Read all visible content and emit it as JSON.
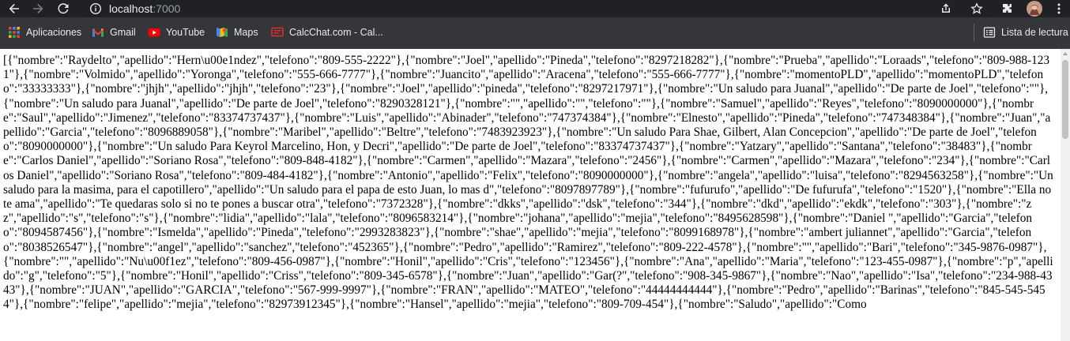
{
  "browser": {
    "url_host": "localhost",
    "url_port": ":7000",
    "reading_list_label": "Lista de lectura"
  },
  "bookmarks": [
    {
      "label": "Aplicaciones",
      "icon": "apps-grid-icon"
    },
    {
      "label": "Gmail",
      "icon": "gmail-icon"
    },
    {
      "label": "YouTube",
      "icon": "youtube-icon"
    },
    {
      "label": "Maps",
      "icon": "maps-icon"
    },
    {
      "label": "CalcChat.com - Cal...",
      "icon": "calcchat-icon"
    }
  ],
  "page": {
    "json_text": "[{\"nombre\":\"Raydelto\",\"apellido\":\"Hern\\u00e1ndez\",\"telefono\":\"809-555-2222\"},{\"nombre\":\"Joel\",\"apellido\":\"Pineda\",\"telefono\":\"8297218282\"},{\"nombre\":\"Prueba\",\"apellido\":\"Loraads\",\"telefono\":\"809-988-1231\"},{\"nombre\":\"Volmido\",\"apellido\":\"Yoronga\",\"telefono\":\"555-666-7777\"},{\"nombre\":\"Juancito\",\"apellido\":\"Aracena\",\"telefono\":\"555-666-7777\"},{\"nombre\":\"momentoPLD\",\"apellido\":\"momentoPLD\",\"telefono\":\"33333333\"},{\"nombre\":\"jhjh\",\"apellido\":\"jhjh\",\"telefono\":\"23\"},{\"nombre\":\"Joel\",\"apellido\":\"pineda\",\"telefono\":\"8297217971\"},{\"nombre\":\"Un saludo para Juanal\",\"apellido\":\"De parte de Joel\",\"telefono\":\"\"},{\"nombre\":\"Un saludo para Juanal\",\"apellido\":\"De parte de Joel\",\"telefono\":\"8290328121\"},{\"nombre\":\"\",\"apellido\":\"\",\"telefono\":\"\"},{\"nombre\":\"Samuel\",\"apellido\":\"Reyes\",\"telefono\":\"8090000000\"},{\"nombre\":\"Saul\",\"apellido\":\"Jimenez\",\"telefono\":\"83374737437\"},{\"nombre\":\"Luis\",\"apellido\":\"Abinader\",\"telefono\":\"747374384\"},{\"nombre\":\"Elnesto\",\"apellido\":\"Pineda\",\"telefono\":\"747348384\"},{\"nombre\":\"Juan\",\"apellido\":\"Garcia\",\"telefono\":\"8096889058\"},{\"nombre\":\"Maribel\",\"apellido\":\"Beltre\",\"telefono\":\"7483923923\"},{\"nombre\":\"Un saludo Para Shae, Gilbert, Alan Concepcion\",\"apellido\":\"De parte de Joel\",\"telefono\":\"8090000000\"},{\"nombre\":\"Un saludo Para Keyrol Marcelino, Hon, y Decri\",\"apellido\":\"De parte de Joel\",\"telefono\":\"83374737437\"},{\"nombre\":\"Yatzary\",\"apellido\":\"Santana\",\"telefono\":\"38483\"},{\"nombre\":\"Carlos Daniel\",\"apellido\":\"Soriano Rosa\",\"telefono\":\"809-848-4182\"},{\"nombre\":\"Carmen\",\"apellido\":\"Mazara\",\"telefono\":\"2456\"},{\"nombre\":\"Carmen\",\"apellido\":\"Mazara\",\"telefono\":\"234\"},{\"nombre\":\"Carlos Daniel\",\"apellido\":\"Soriano Rosa\",\"telefono\":\"809-484-4182\"},{\"nombre\":\"Antonio\",\"apellido\":\"Felix\",\"telefono\":\"8090000000\"},{\"nombre\":\"angela\",\"apellido\":\"luisa\",\"telefono\":\"8294563258\"},{\"nombre\":\"Un saludo para la masima, para el capotillero\",\"apellido\":\"Un saludo para el papa de esto Juan, lo mas d\",\"telefono\":\"8097897789\"},{\"nombre\":\"fufurufo\",\"apellido\":\"De fufurufa\",\"telefono\":\"1520\"},{\"nombre\":\"Ella no te ama\",\"apellido\":\"Te quedaras solo si no te pones a buscar otra\",\"telefono\":\"7372328\"},{\"nombre\":\"dkks\",\"apellido\":\"dsk\",\"telefono\":\"344\"},{\"nombre\":\"dkd\",\"apellido\":\"ekdk\",\"telefono\":\"303\"},{\"nombre\":\"zz\",\"apellido\":\"s\",\"telefono\":\"s\"},{\"nombre\":\"lidia\",\"apellido\":\"lala\",\"telefono\":\"8096583214\"},{\"nombre\":\"johana\",\"apellido\":\"mejia\",\"telefono\":\"8495628598\"},{\"nombre\":\"Daniel \",\"apellido\":\"Garcia\",\"telefono\":\"8094587456\"},{\"nombre\":\"Ismelda\",\"apellido\":\"Pineda\",\"telefono\":\"2993283823\"},{\"nombre\":\"shae\",\"apellido\":\"mejia\",\"telefono\":\"8099168978\"},{\"nombre\":\"ambert juliannet\",\"apellido\":\"Garcia\",\"telefono\":\"8038526547\"},{\"nombre\":\"angel\",\"apellido\":\"sanchez\",\"telefono\":\"452365\"},{\"nombre\":\"Pedro\",\"apellido\":\"Ramirez\",\"telefono\":\"809-222-4578\"},{\"nombre\":\"\",\"apellido\":\"Bari\",\"telefono\":\"345-9876-0987\"},{\"nombre\":\"\",\"apellido\":\"Nu\\u00f1ez\",\"telefono\":\"809-456-0987\"},{\"nombre\":\"Honil\",\"apellido\":\"Cris\",\"telefono\":\"123456\"},{\"nombre\":\"Ana\",\"apellido\":\"Maria\",\"telefono\":\"123-455-0987\"},{\"nombre\":\"p\",\"apellido\":\"g\",\"telefono\":\"5\"},{\"nombre\":\"Honil\",\"apellido\":\"Criss\",\"telefono\":\"809-345-6578\"},{\"nombre\":\"Juan\",\"apellido\":\"Gar(?\",\"telefono\":\"908-345-9867\"},{\"nombre\":\"Nao\",\"apellido\":\"Isa\",\"telefono\":\"234-988-4343\"},{\"nombre\":\"JUAN\",\"apellido\":\"GARCIA\",\"telefono\":\"567-999-9997\"},{\"nombre\":\"FRAN\",\"apellido\":\"MATEO\",\"telefono\":\"44444444444\"},{\"nombre\":\"Pedro\",\"apellido\":\"Barinas\",\"telefono\":\"845-545-5454\"},{\"nombre\":\"felipe\",\"apellido\":\"mejia\",\"telefono\":\"82973912345\"},{\"nombre\":\"Hansel\",\"apellido\":\"mejia\",\"telefono\":\"809-709-454\"},{\"nombre\":\"Saludo\",\"apellido\":\"Como"
  },
  "colors": {
    "toolbar_bg": "#202124",
    "bookmarks_bg": "#35363a",
    "text_light": "#e8eaed",
    "url_dim": "#9aa0a6"
  }
}
